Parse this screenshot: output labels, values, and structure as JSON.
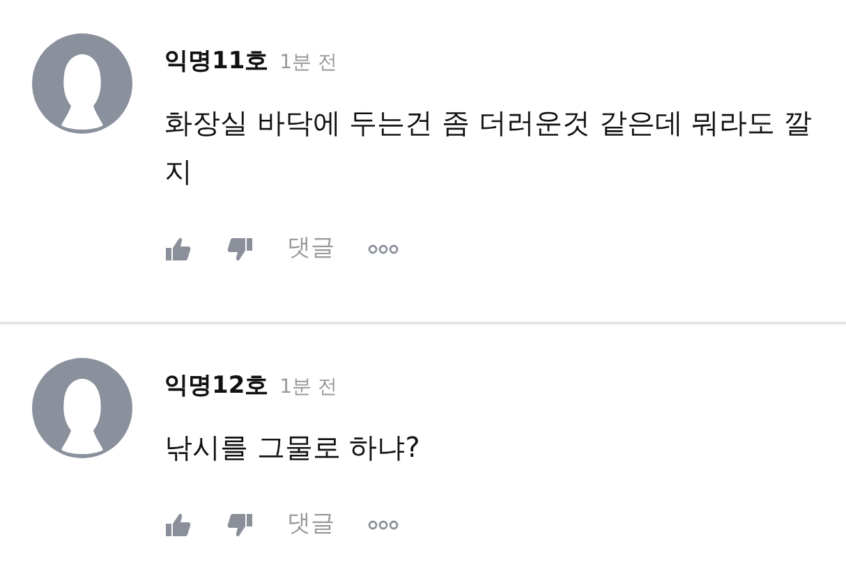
{
  "comments": [
    {
      "author": "익명11호",
      "time": "1분 전",
      "text": "화장실 바닥에 두는건 좀 더러운것 같은데 뭐라도 깔지",
      "reply_label": "댓글"
    },
    {
      "author": "익명12호",
      "time": "1분 전",
      "text": "낚시를 그물로 하냐?",
      "reply_label": "댓글"
    }
  ]
}
